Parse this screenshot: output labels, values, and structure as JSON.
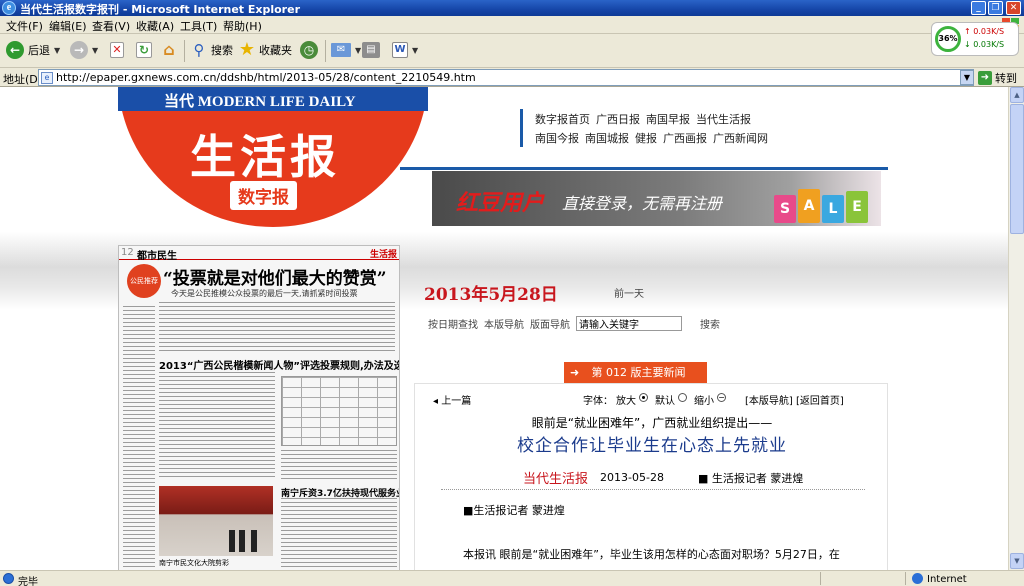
{
  "window": {
    "title": "当代生活报数字报刊 - Microsoft Internet Explorer",
    "minimize": "_",
    "restore": "❐",
    "close": "✕"
  },
  "menu": [
    "文件(F)",
    "编辑(E)",
    "查看(V)",
    "收藏(A)",
    "工具(T)",
    "帮助(H)"
  ],
  "toolbar": {
    "back": "后退",
    "search": "搜索",
    "favorites": "收藏夹"
  },
  "network": {
    "percent": "36%",
    "up": "0.03K/S",
    "down": "0.03K/S"
  },
  "address": {
    "label": "地址(D)",
    "url": "http://epaper.gxnews.com.cn/ddshb/html/2013-05/28/content_2210549.htm",
    "go": "转到"
  },
  "logo": {
    "en": "当代 MODERN LIFE DAILY",
    "zh": "生活报",
    "sub": "数字报"
  },
  "nav": {
    "row1": [
      "数字报首页",
      "广西日报",
      "南国早报",
      "当代生活报"
    ],
    "row2": [
      "南国今报",
      "南国城报",
      "健报",
      "广西画报",
      "广西新闻网"
    ]
  },
  "banner": {
    "brand": "红豆用户",
    "text": "直接登录，无需再注册",
    "bags": [
      "S",
      "A",
      "L",
      "E"
    ]
  },
  "paper": {
    "page": "12",
    "section": "都市民生",
    "brand": "生活报",
    "badge": "公民推荐",
    "headline": "“投票就是对他们最大的赞赏”",
    "subhead": "今天是公民推模公众投票的最后一天,请抓紧时间投票",
    "headline2": "2013“广西公民楷模新闻人物”评选投票规则,办法及选票",
    "headline3": "南宁斥资3.7亿扶持现代服务业",
    "caption": "南宁市民文化大院剪彩"
  },
  "date": "2013年5月28日",
  "prev_day": "前一天",
  "search": {
    "links": [
      "按日期查找",
      "本版导航",
      "版面导航"
    ],
    "placeholder": "请输入关键字",
    "button": "搜索"
  },
  "edition": "第 012 版主要新闻",
  "article": {
    "prev": "◂ 上一篇",
    "font_label": "字体：",
    "font_large": "放大",
    "font_default": "默认",
    "font_small": "缩小",
    "links": "[本版导航] [返回首页]",
    "kicker": "眼前是“就业困难年”，广西就业组织提出——",
    "headline": "校企合作让毕业生在心态上先就业",
    "source": "当代生活报",
    "pubdate": "2013-05-28",
    "author": "■ 生活报记者 蒙进煌",
    "byline": "■生活报记者 蒙进煌",
    "para": "本报讯 眼前是“就业困难年”，毕业生该用怎样的心态面对职场？5月27日，在"
  },
  "status": {
    "text": "完毕",
    "zone": "Internet"
  },
  "colors": {
    "brand_red": "#e63a1c",
    "brand_blue": "#1a4fa8",
    "date_red": "#c8161d",
    "headline_blue": "#1b3b8c"
  }
}
